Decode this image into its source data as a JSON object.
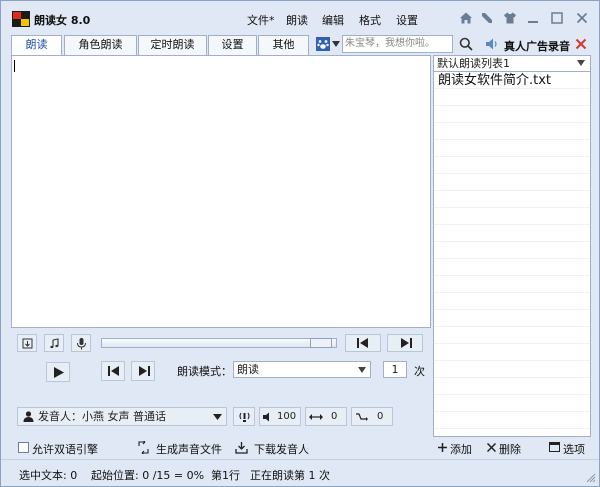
{
  "titlebar": {
    "app_title": "朗读女 8.0",
    "menus": [
      "文件*",
      "朗读",
      "编辑",
      "格式",
      "设置"
    ],
    "icons": [
      "home-icon",
      "tools-icon",
      "shirt-icon",
      "minimize-icon",
      "restore-icon",
      "close-icon"
    ]
  },
  "tabs": [
    {
      "label": "朗读",
      "active": true
    },
    {
      "label": "角色朗读",
      "active": false
    },
    {
      "label": "定时朗读",
      "active": false
    },
    {
      "label": "设置",
      "active": false
    },
    {
      "label": "其他",
      "active": false
    }
  ],
  "tts_input": {
    "value": "朱宝琴，我想你啦。"
  },
  "ad_record_label": "真人广告录音",
  "editor": {
    "text": ""
  },
  "playlist": {
    "selected": "默认朗读列表1",
    "items": [
      "朗读女软件简介.txt"
    ]
  },
  "controls": {
    "mode_label": "朗读模式：",
    "mode_value": "朗读",
    "repeat_value": "1",
    "repeat_unit": "次",
    "voice_label": "发音人：小燕  女声  普通话",
    "volume": "100",
    "speed": "0",
    "pitch": "0"
  },
  "bottom": {
    "dual_engine_label": "允许双语引擎",
    "generate_audio_label": "生成声音文件",
    "download_voice_label": "下载发音人",
    "add_label": "添加",
    "delete_label": "删除",
    "options_label": "选项"
  },
  "status": {
    "selected_text": "选中文本: 0",
    "start_position": "起始位置: 0 /15 = 0%",
    "line": "第1行",
    "reading": "正在朗读第 1 次"
  },
  "colors": {
    "chrome": "#dfe8f4",
    "border": "#9fb0c8",
    "close_red": "#d13b2f",
    "accent_blue": "#1f4fa5"
  }
}
